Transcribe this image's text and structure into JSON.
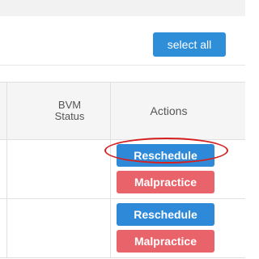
{
  "toolbar": {
    "select_all_label": "select all"
  },
  "table": {
    "headers": {
      "bvm_status": "BVM Status",
      "actions": "Actions"
    },
    "rows": [
      {
        "bvm_status": "",
        "actions": [
          "Reschedule",
          "Malpractice"
        ]
      },
      {
        "bvm_status": "",
        "actions": [
          "Reschedule",
          "Malpractice"
        ]
      }
    ]
  },
  "colors": {
    "primary_button": "#2e8ad8",
    "danger_button": "#e9636b",
    "highlight_ring": "#d62020"
  }
}
